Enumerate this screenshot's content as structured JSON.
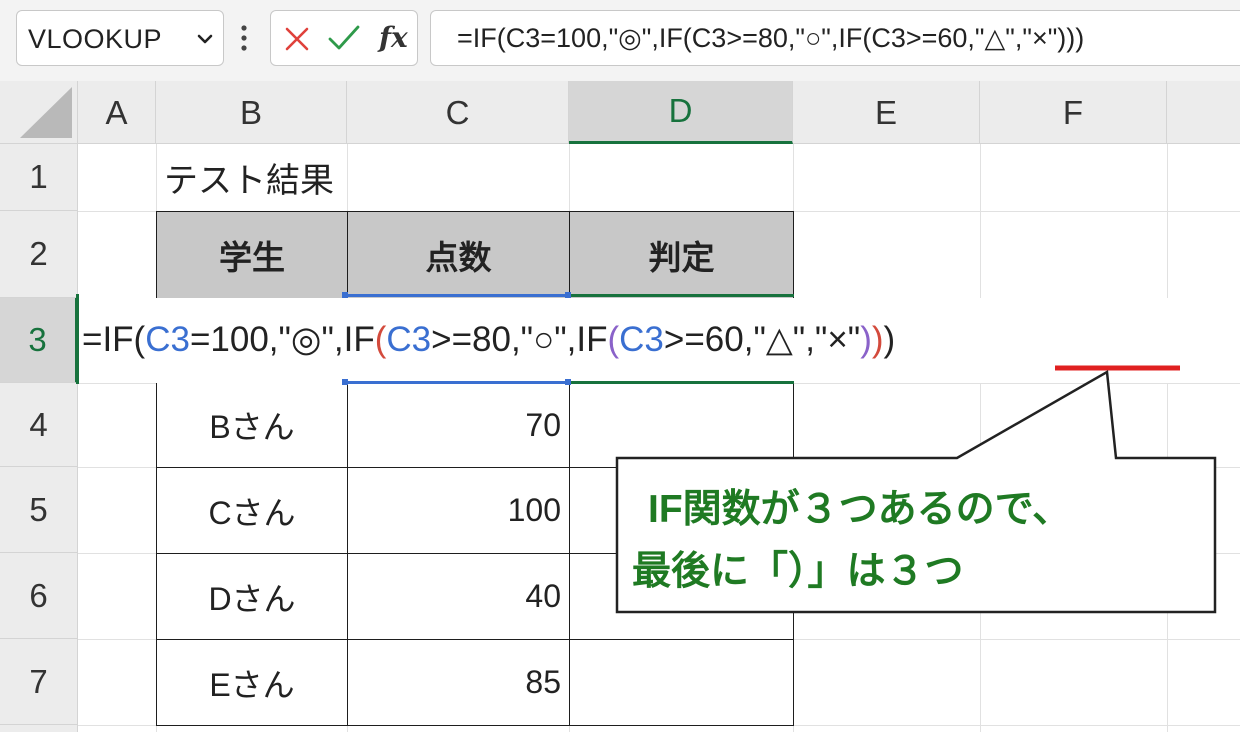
{
  "formula_bar": {
    "name_box": "VLOOKUP",
    "fx_label": "fx",
    "formula": "=IF(C3=100,\"◎\",IF(C3>=80,\"○\",IF(C3>=60,\"△\",\"×\")))"
  },
  "columns": [
    "A",
    "B",
    "C",
    "D",
    "E",
    "F"
  ],
  "rows": [
    "1",
    "2",
    "3",
    "4",
    "5",
    "6",
    "7"
  ],
  "selected_column": "D",
  "selected_row": "3",
  "sheet": {
    "title": "テスト結果",
    "headers": [
      "学生",
      "点数",
      "判定"
    ],
    "records": [
      {
        "student": "Bさん",
        "score": "70",
        "result": ""
      },
      {
        "student": "Cさん",
        "score": "100",
        "result": ""
      },
      {
        "student": "Dさん",
        "score": "40",
        "result": ""
      },
      {
        "student": "Eさん",
        "score": "85",
        "result": ""
      }
    ]
  },
  "edit_formula_parts": {
    "p1": "=IF(",
    "p2": "C3",
    "p3": "=100,\"◎\",IF",
    "p4": "(",
    "p5": "C3",
    "p6": ">=80,\"○\",IF",
    "p7": "(",
    "p8": "C3",
    "p9": ">=60,\"△\",\"×\"",
    "p10": ")",
    "p11": ")",
    "p12": ")"
  },
  "callout": {
    "line1": "IF関数が３つあるので、",
    "line2": "最後に「）」は３つ"
  },
  "colors": {
    "excel_green": "#17723d",
    "ref_blue": "#3a6fd1",
    "ref_red": "#d34a3c",
    "ref_purple": "#8a62c9",
    "underline_red": "#e02020",
    "callout_text": "#1f7a23"
  }
}
